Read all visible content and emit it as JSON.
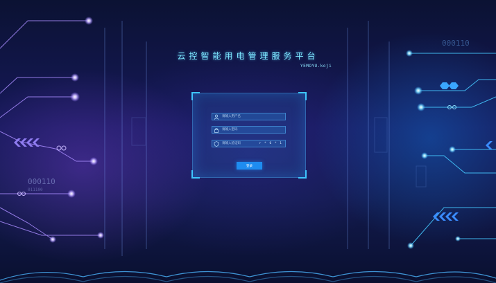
{
  "header": {
    "title": "云控智能用电管理服务平台",
    "subtitle": "YEMOYU.koji"
  },
  "login": {
    "username_placeholder": "请输入用户名",
    "password_placeholder": "请输入密码",
    "captcha_placeholder": "请输入验证码",
    "captcha_code": "r * 6 * 1",
    "submit_label": "登录"
  },
  "decor": {
    "left_binary_label": "000110",
    "left_binary_small": "011100",
    "right_binary_label": "000110"
  },
  "colors": {
    "accent": "#1e8cf0",
    "title": "#7ee8ff",
    "circuit_left": "#a98cff",
    "circuit_right": "#45c8ff"
  }
}
